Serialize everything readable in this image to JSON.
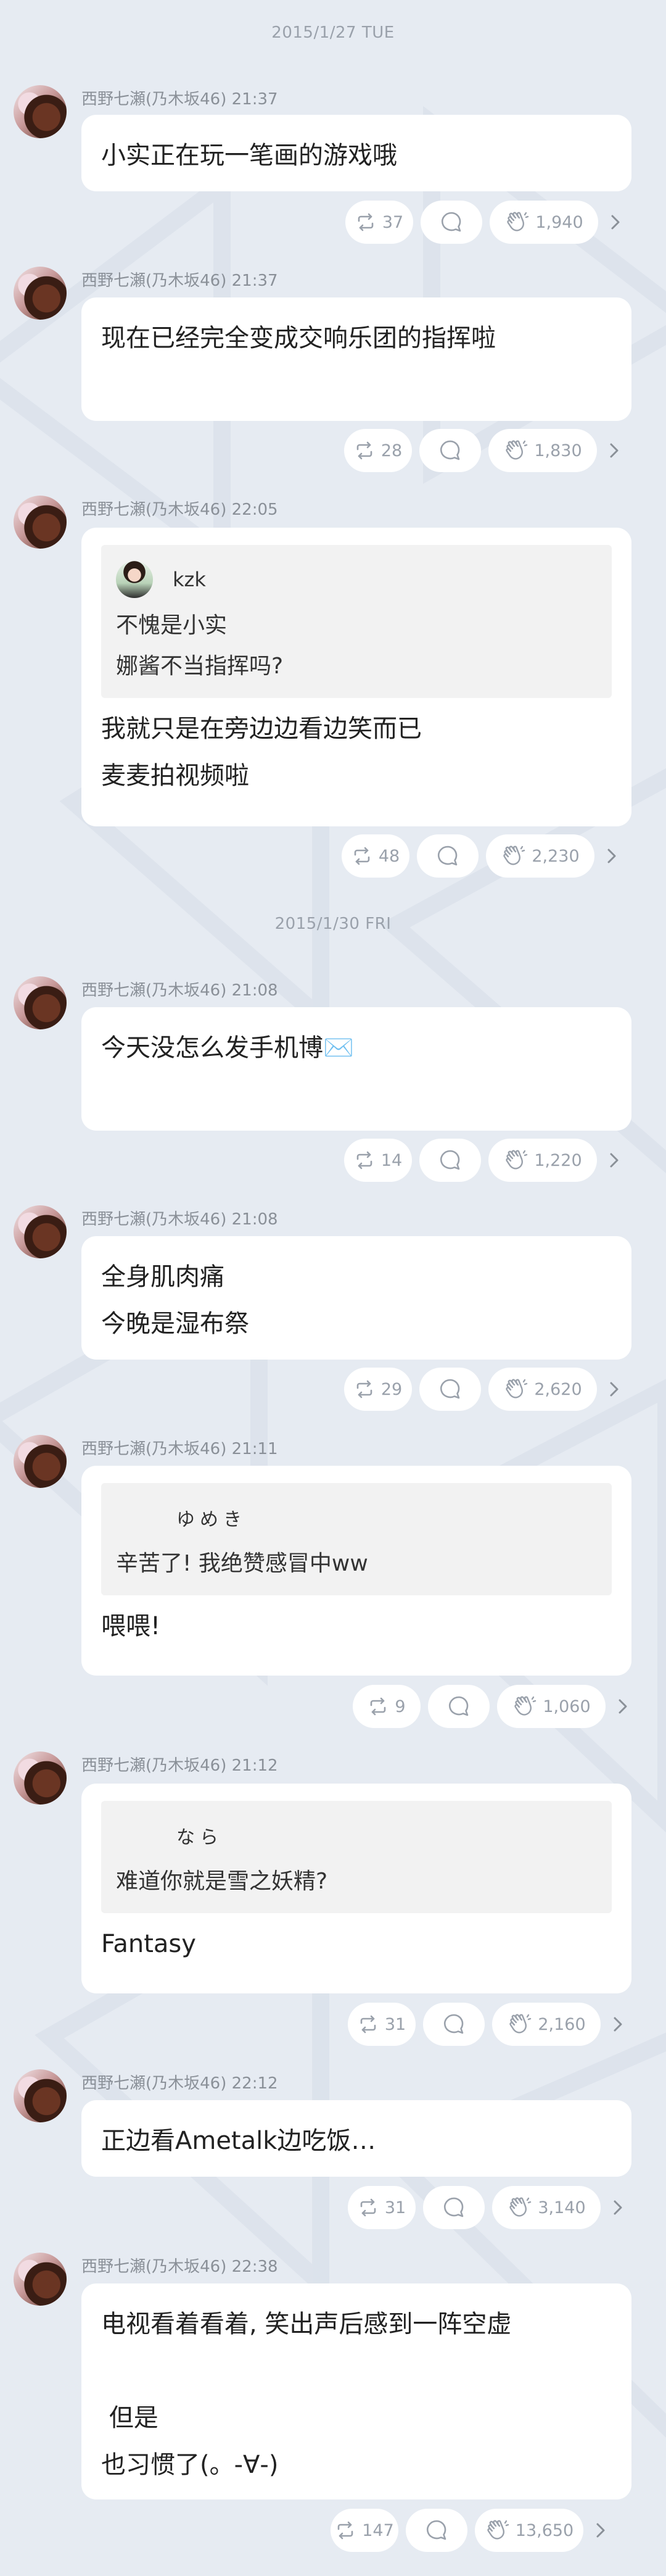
{
  "dates": [
    "2015/1/27 TUE",
    "2015/1/30 FRI"
  ],
  "posts": [
    {
      "author": "西野七瀬(乃木坂46) 21:37",
      "lines": [
        "小实正在玩一笔画的游戏哦"
      ],
      "reposts": "37",
      "likes": "1,940"
    },
    {
      "author": "西野七瀬(乃木坂46) 21:37",
      "lines": [
        "现在已经完全变成交响乐团的指挥啦"
      ],
      "reposts": "28",
      "likes": "1,830"
    },
    {
      "author": "西野七瀬(乃木坂46) 22:05",
      "quote": {
        "name": "kzk",
        "lines": [
          "不愧是小实",
          "娜酱不当指挥吗?"
        ]
      },
      "lines": [
        "我就只是在旁边边看边笑而已",
        "麦麦拍视频啦"
      ],
      "reposts": "48",
      "likes": "2,230"
    },
    {
      "author": "西野七瀬(乃木坂46) 21:08",
      "lines": [
        "今天没怎么发手机博✉️"
      ],
      "reposts": "14",
      "likes": "1,220"
    },
    {
      "author": "西野七瀬(乃木坂46) 21:08",
      "lines": [
        "全身肌肉痛",
        "今晚是湿布祭"
      ],
      "reposts": "29",
      "likes": "2,620"
    },
    {
      "author": "西野七瀬(乃木坂46) 21:11",
      "quote": {
        "name": "ゆめき",
        "lines": [
          "辛苦了! 我绝赞感冒中ww"
        ]
      },
      "lines": [
        "喂喂!"
      ],
      "reposts": "9",
      "likes": "1,060"
    },
    {
      "author": "西野七瀬(乃木坂46) 21:12",
      "quote": {
        "name": "なら",
        "lines": [
          "难道你就是雪之妖精?"
        ]
      },
      "lines": [
        "Fantasy"
      ],
      "reposts": "31",
      "likes": "2,160"
    },
    {
      "author": "西野七瀬(乃木坂46) 22:12",
      "lines": [
        "正边看Ametalk边吃饭…"
      ],
      "reposts": "31",
      "likes": "3,140"
    },
    {
      "author": "西野七瀬(乃木坂46) 22:38",
      "lines": [
        "电视看着看着, 笑出声后感到一阵空虚",
        "",
        " 但是",
        "也习惯了(。-∀-)"
      ],
      "reposts": "147",
      "likes": "13,650"
    }
  ],
  "icons": {
    "repost": "repost-icon",
    "comment": "comment-icon",
    "like": "clap-icon",
    "more": "chevron-right-icon"
  },
  "colors": {
    "background": "#e6ebf2",
    "card": "#ffffff",
    "muted": "#9aa1ab"
  }
}
